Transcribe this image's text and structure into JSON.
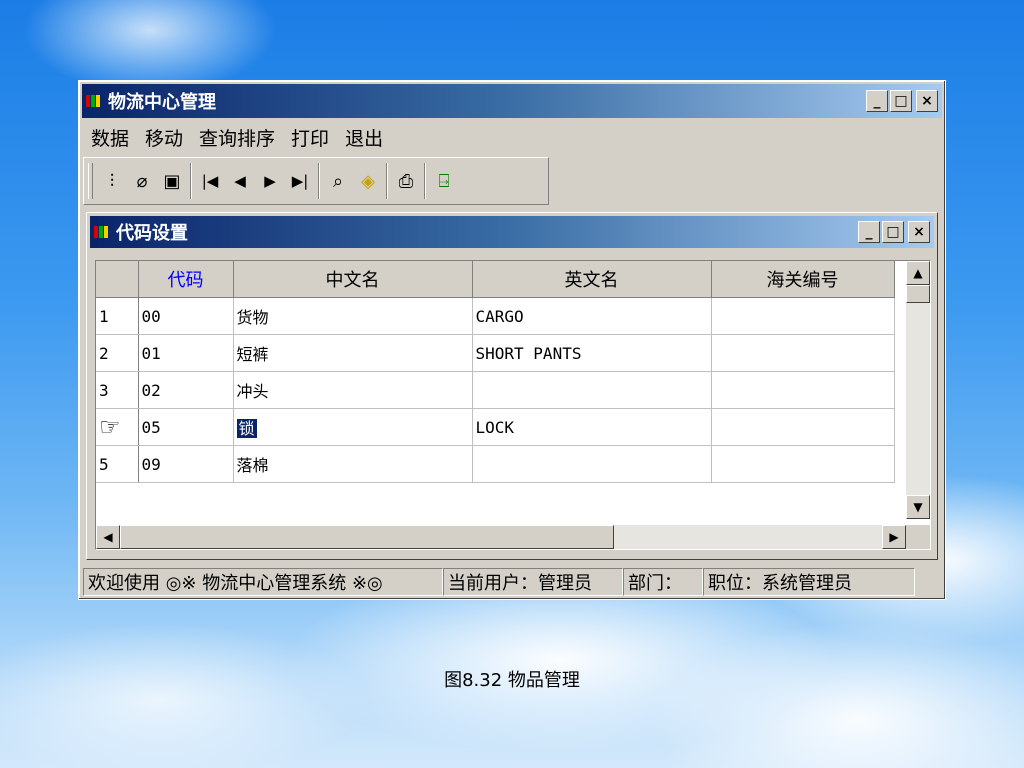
{
  "main_window": {
    "title": "物流中心管理",
    "menu": [
      "数据",
      "移动",
      "查询排序",
      "打印",
      "退出"
    ],
    "controls": {
      "minimize": "_",
      "maximize": "□",
      "close": "×"
    }
  },
  "toolbar": {
    "icons": [
      "select-icon",
      "eraser-icon",
      "save-icon",
      "first-record-icon",
      "prev-record-icon",
      "next-record-icon",
      "last-record-icon",
      "find-icon",
      "filter-icon",
      "print-icon",
      "exit-door-icon"
    ],
    "glyphs": {
      "select": "⫶",
      "eraser": "⌀",
      "save": "▣",
      "first": "|◀",
      "prev": "◀",
      "next": "▶",
      "last": "▶|",
      "find": "⌕",
      "filter": "◈",
      "print": "⎙",
      "exit": "⍈"
    }
  },
  "child_window": {
    "title": "代码设置",
    "columns": [
      "代码",
      "中文名",
      "英文名",
      "海关编号"
    ],
    "rows": [
      {
        "num": "1",
        "code": "00",
        "cn": "货物",
        "en": "CARGO",
        "customs": ""
      },
      {
        "num": "2",
        "code": "01",
        "cn": "短裤",
        "en": "SHORT PANTS",
        "customs": ""
      },
      {
        "num": "3",
        "code": "02",
        "cn": "冲头",
        "en": "",
        "customs": ""
      },
      {
        "num": "☞",
        "code": "05",
        "cn": "锁",
        "en": "LOCK",
        "customs": ""
      },
      {
        "num": "5",
        "code": "09",
        "cn": "落棉",
        "en": "",
        "customs": ""
      }
    ],
    "scroll": {
      "up": "▲",
      "down": "▼",
      "left": "◀",
      "right": "▶"
    }
  },
  "statusbar": {
    "welcome": "欢迎使用 ◎※ 物流中心管理系统 ※◎",
    "user": "当前用户：管理员",
    "dept": "部门：",
    "role": "职位：系统管理员"
  },
  "caption": "图8.32  物品管理"
}
